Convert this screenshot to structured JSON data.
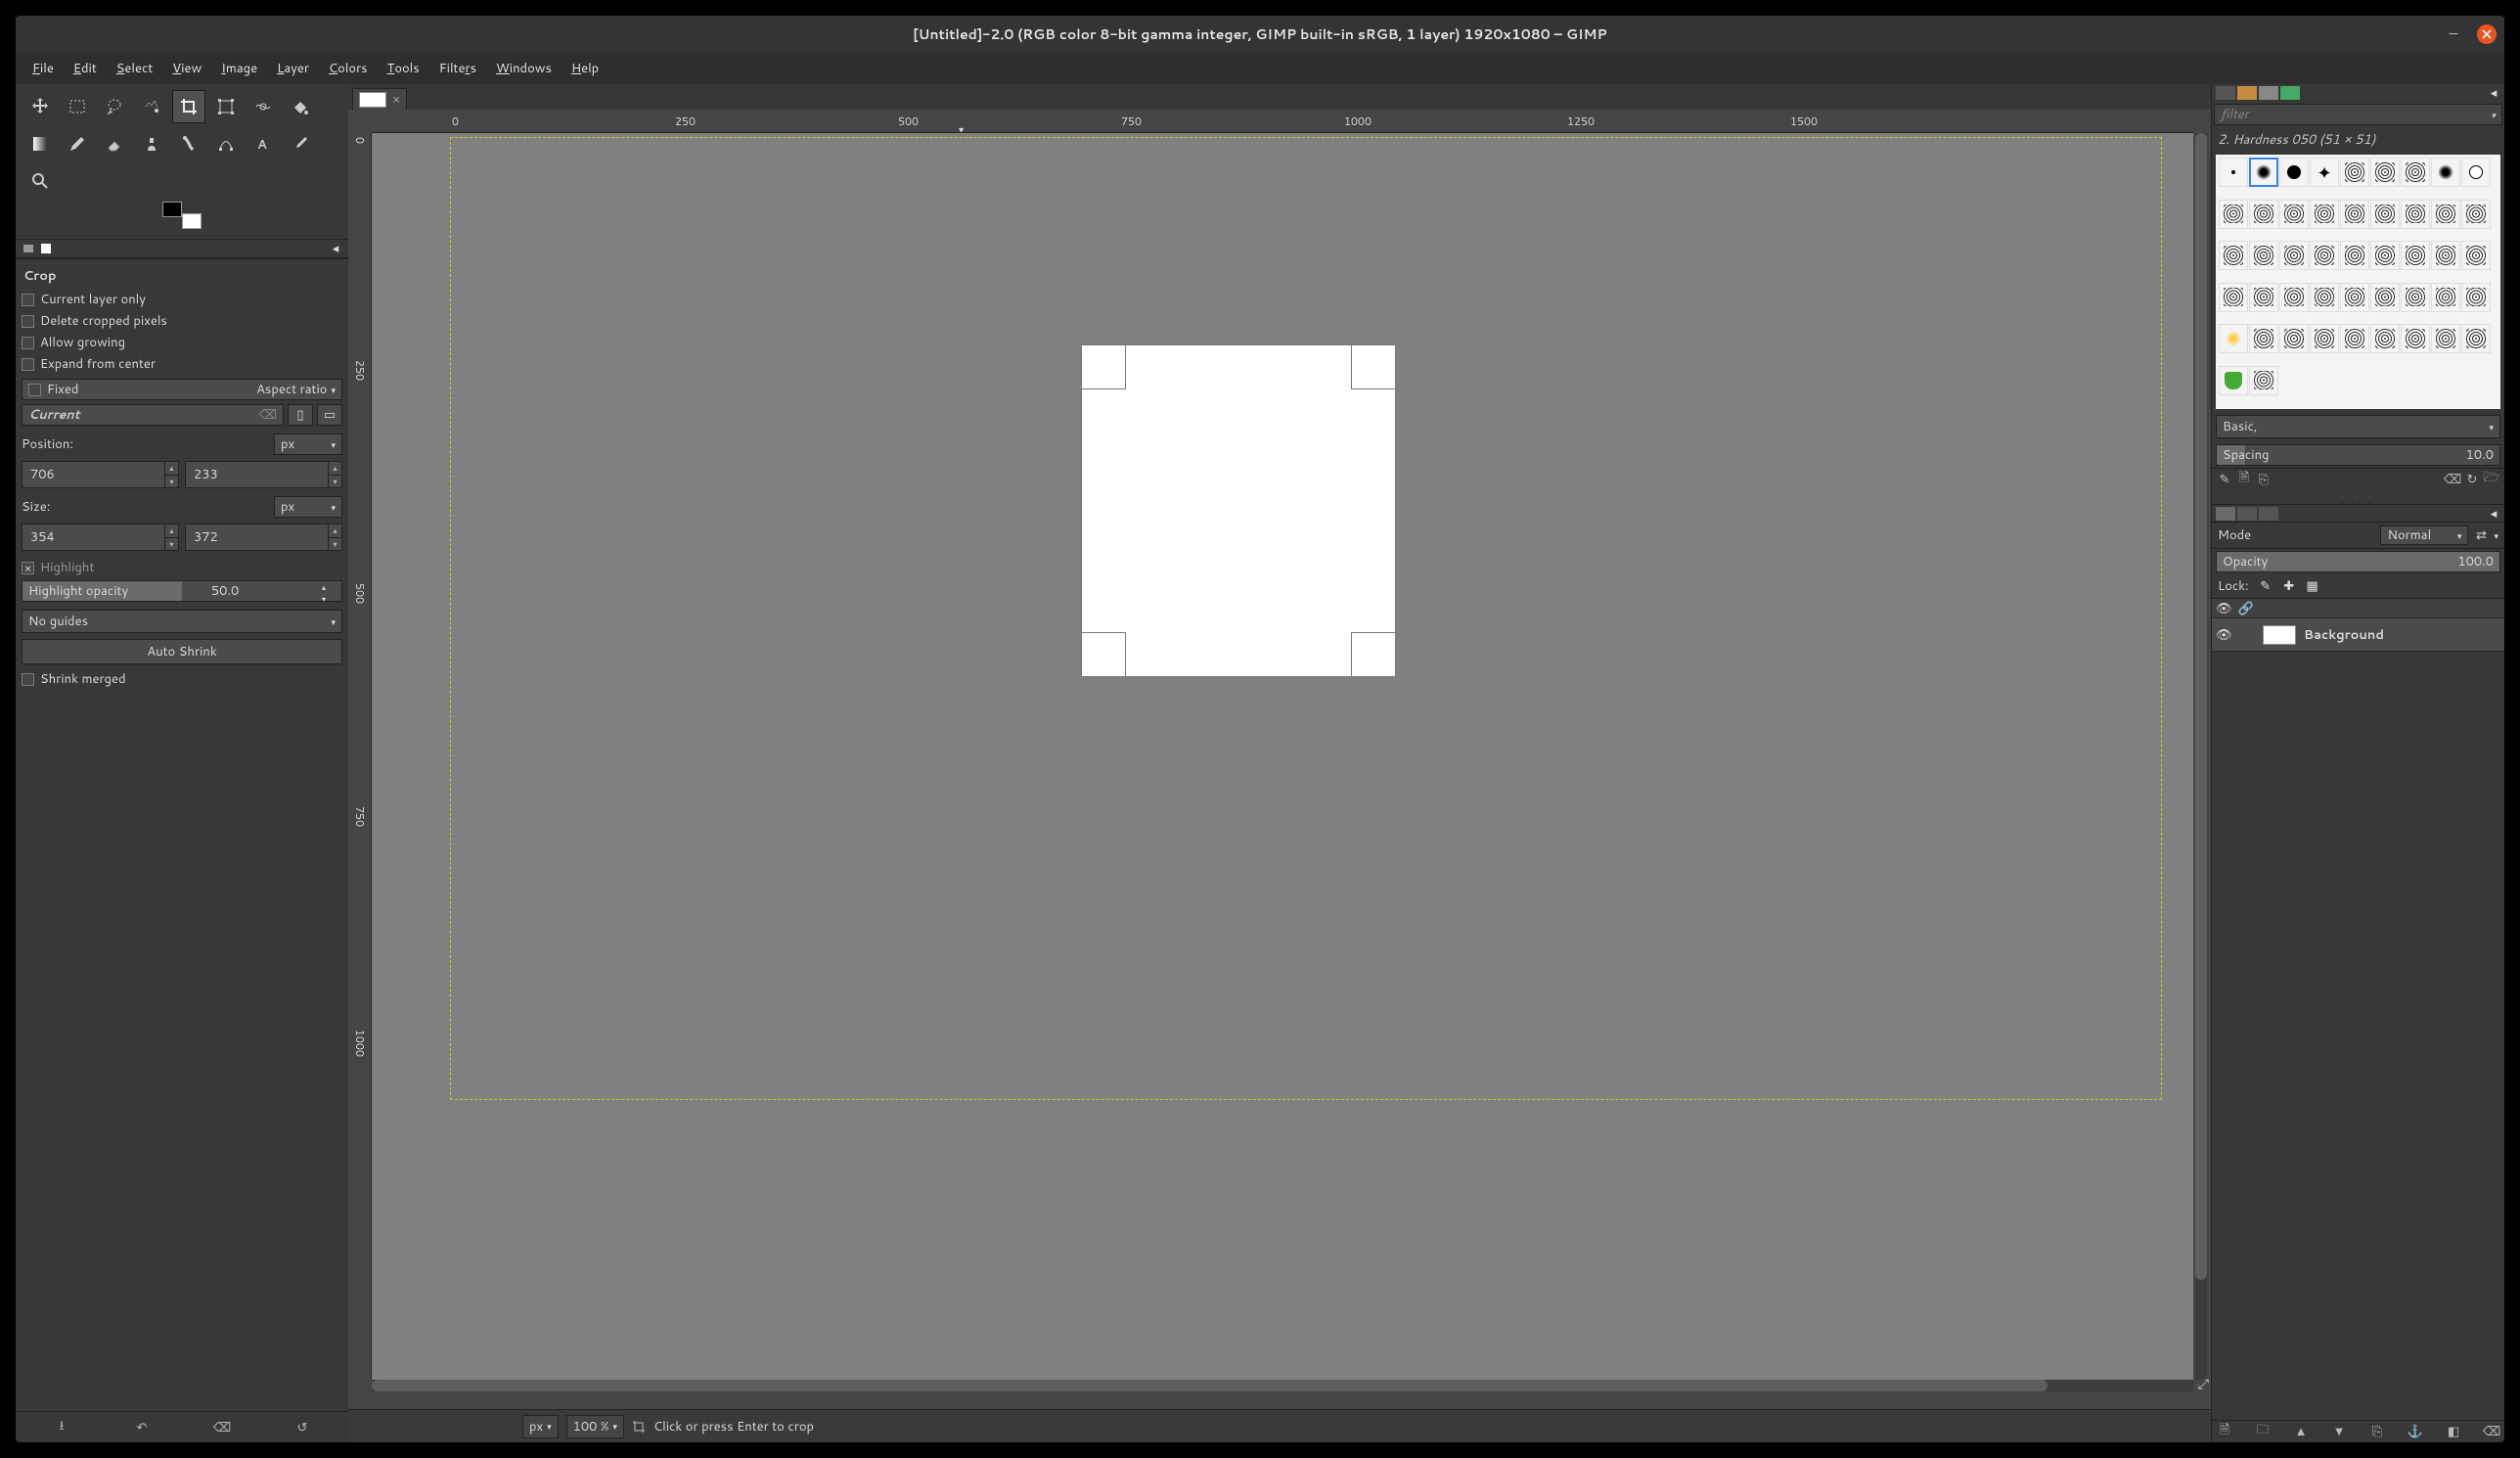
{
  "window": {
    "title": "[Untitled]-2.0 (RGB color 8-bit gamma integer, GIMP built-in sRGB, 1 layer) 1920x1080 – GIMP"
  },
  "menu": [
    "File",
    "Edit",
    "Select",
    "View",
    "Image",
    "Layer",
    "Colors",
    "Tools",
    "Filters",
    "Windows",
    "Help"
  ],
  "tool_options": {
    "title": "Crop",
    "current_layer_only": "Current layer only",
    "delete_cropped": "Delete cropped pixels",
    "allow_growing": "Allow growing",
    "expand_center": "Expand from center",
    "fixed_label": "Fixed",
    "fixed_mode": "Aspect ratio",
    "fixed_value": "Current",
    "position_label": "Position:",
    "position_unit": "px",
    "pos_x": "706",
    "pos_y": "233",
    "size_label": "Size:",
    "size_unit": "px",
    "size_w": "354",
    "size_h": "372",
    "highlight_label": "Highlight",
    "highlight_opacity_label": "Highlight opacity",
    "highlight_opacity_value": "50.0",
    "guides": "No guides",
    "auto_shrink": "Auto Shrink",
    "shrink_merged": "Shrink merged"
  },
  "canvas": {
    "zoom": "100 %",
    "unit": "px",
    "status": "Click or press Enter to crop",
    "hruler_ticks": [
      "0",
      "250",
      "500",
      "750",
      "1000",
      "1250",
      "1500"
    ],
    "vruler_ticks": [
      "0",
      "250",
      "500",
      "750",
      "1000"
    ]
  },
  "brushes": {
    "filter_placeholder": "filter",
    "info": "2. Hardness 050 (51 × 51)",
    "preset": "Basic,",
    "spacing_label": "Spacing",
    "spacing_value": "10.0"
  },
  "layers": {
    "mode_label": "Mode",
    "mode_value": "Normal",
    "opacity_label": "Opacity",
    "opacity_value": "100.0",
    "lock_label": "Lock:",
    "layer_name": "Background"
  }
}
